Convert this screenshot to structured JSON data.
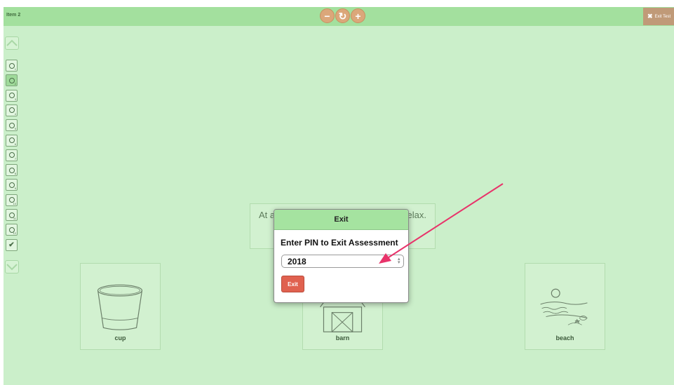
{
  "topbar": {
    "item_label": "Item 2",
    "zoom_out": "−",
    "zoom_reset": "↻",
    "zoom_in": "+",
    "exit_test_label": "Exit Test"
  },
  "sidebar": {
    "questions": [
      "",
      "",
      "",
      "",
      "",
      "",
      "",
      "",
      "",
      "",
      "",
      ""
    ],
    "numbers": [
      "1",
      "2",
      "3",
      "4",
      "5",
      "6",
      "7",
      "8",
      "9",
      "10",
      "11",
      "12"
    ],
    "active_index": 1,
    "review_icon": "check-icon"
  },
  "question": {
    "text_start": "At a",
    "text_end": "elax."
  },
  "choices": [
    {
      "label": "cup",
      "icon": "cup-icon"
    },
    {
      "label": "barn",
      "icon": "barn-icon"
    },
    {
      "label": "beach",
      "icon": "beach-icon"
    }
  ],
  "dialog": {
    "title": "Exit",
    "prompt": "Enter PIN to Exit Assessment",
    "pin_value": "2018",
    "exit_button": "Exit"
  },
  "colors": {
    "background": "#cbefca",
    "topbar": "#a3e09e",
    "zoom_buttons": "#dba77a",
    "exit_button": "#e0614f",
    "annotation_arrow": "#e8336a"
  }
}
